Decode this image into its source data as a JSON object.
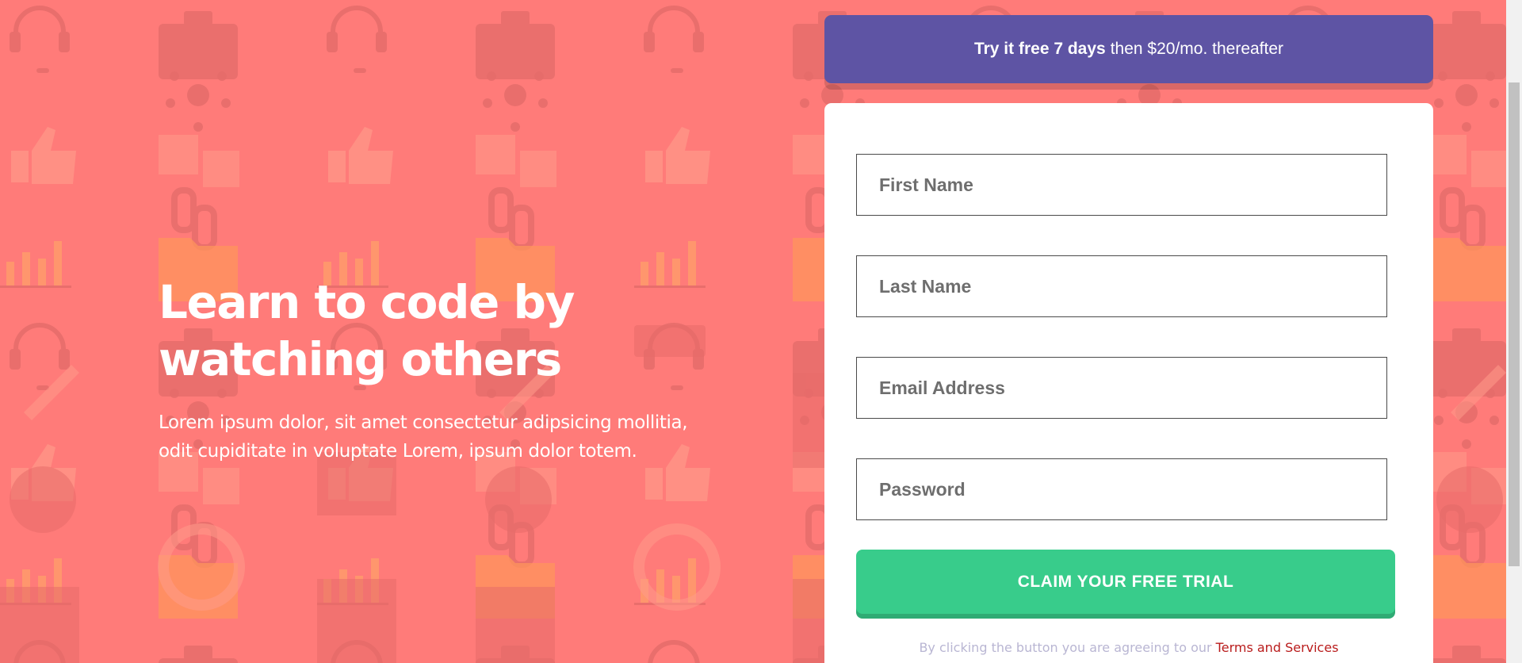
{
  "colors": {
    "background": "#ff7b79",
    "banner": "#5e54a4",
    "cta": "#38cc8b",
    "terms_link": "#b91c1c"
  },
  "hero": {
    "title_line1": "Learn to code by",
    "title_line2": "watching others",
    "body_line1": "Lorem ipsum dolor, sit amet consectetur adipsicing mollitia,",
    "body_line2": "odit cupiditate in voluptate Lorem, ipsum dolor totem."
  },
  "promo": {
    "bold": "Try it free 7 days",
    "rest": "then $20/mo. thereafter"
  },
  "form": {
    "first_name_placeholder": "First Name",
    "last_name_placeholder": "Last Name",
    "email_placeholder": "Email Address",
    "password_placeholder": "Password",
    "submit_label": "CLAIM YOUR FREE TRIAL",
    "terms_prefix": "By clicking the button you are agreeing to our",
    "terms_link": "Terms and Services"
  },
  "background_icons": [
    "headset-icon",
    "toolbox-icon",
    "network-icon",
    "thumbs-up-icon",
    "puzzle-icon",
    "chain-link-icon",
    "chart-icon",
    "folder-icon",
    "rocket-icon",
    "pencil-icon",
    "globe-icon",
    "life-ring-icon",
    "calendar-icon",
    "house-icon",
    "key-icon",
    "cart-icon"
  ]
}
